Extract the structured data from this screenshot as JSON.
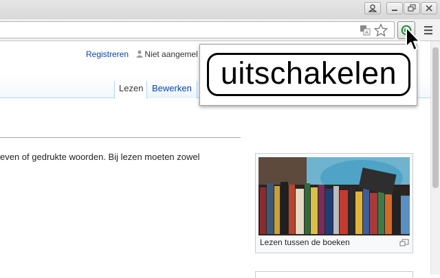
{
  "toolbar": {
    "translate_icon": "translate-icon",
    "bookmark_icon": "star-icon",
    "extension_icon": "green-record-icon",
    "extension_color": "#2ea44f",
    "menu_icon": "hamburger-menu-icon"
  },
  "personal_tools": {
    "register_label": "Registreren",
    "not_logged_in_label": "Niet aangemel"
  },
  "tabs": [
    {
      "label": "Lezen",
      "selected": true
    },
    {
      "label": "Bewerken",
      "selected": false
    }
  ],
  "article": {
    "text_fragment": "even of gedrukte woorden. Bij lezen moeten zowel"
  },
  "thumbnail": {
    "caption": "Lezen tussen de boeken",
    "image_icon": "bookshelf-photo",
    "enlarge_icon": "magnify-icon"
  },
  "callout": {
    "text": "uitschakelen"
  },
  "colors": {
    "link": "#0645ad",
    "tab_border": "#a7d7f9"
  }
}
